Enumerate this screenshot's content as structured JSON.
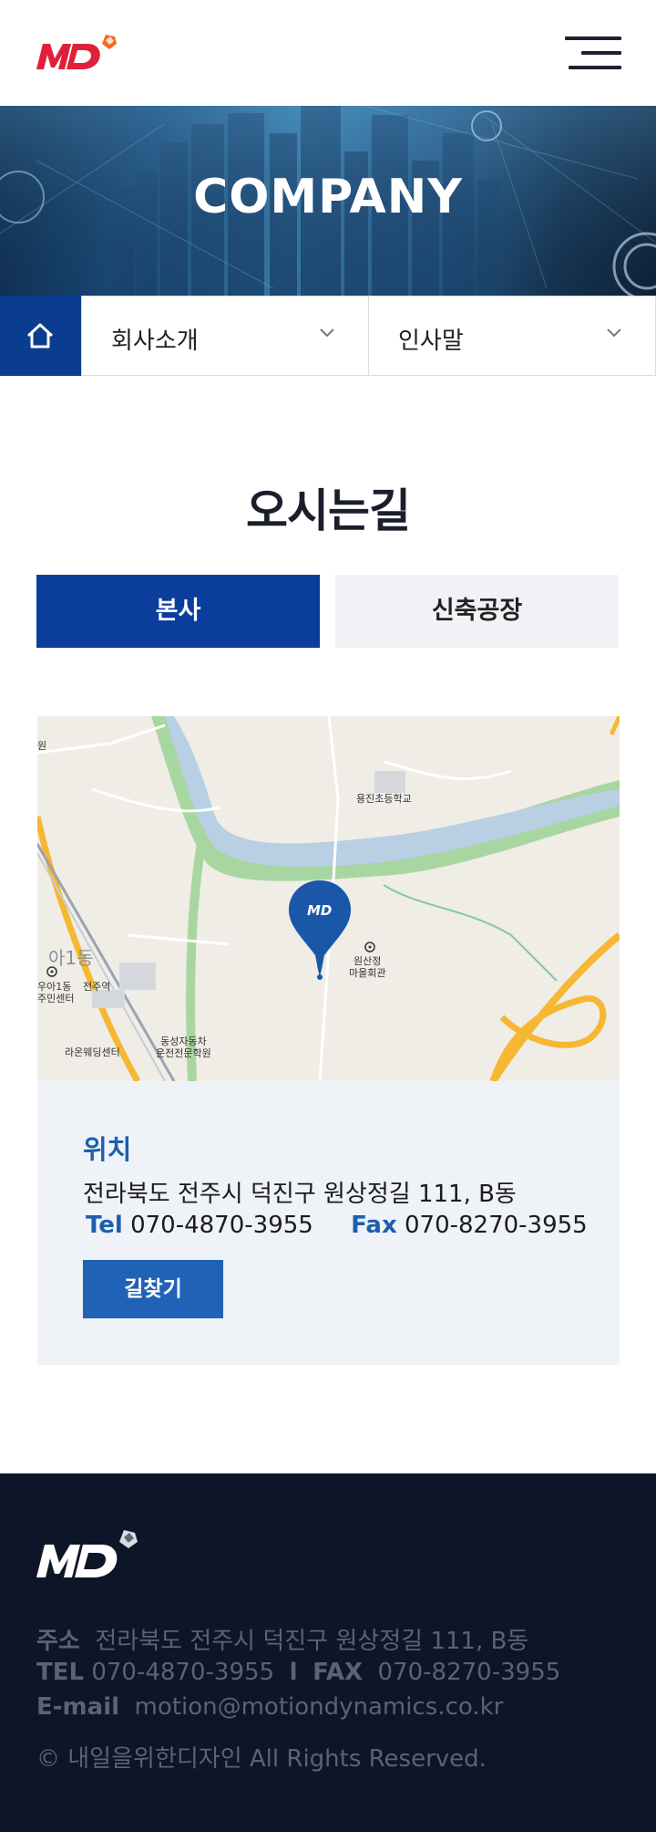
{
  "header": {
    "logo_text": "MD",
    "brand_color": "#e0203a",
    "accent_color": "#f26b1d"
  },
  "banner": {
    "title": "COMPANY"
  },
  "subnav": {
    "home_icon": "home-icon",
    "dropdown1": "회사소개",
    "dropdown2": "인사말"
  },
  "main": {
    "title": "오시는길",
    "tabs": [
      {
        "label": "본사",
        "active": true
      },
      {
        "label": "신축공장",
        "active": false
      }
    ],
    "map": {
      "labels": {
        "school": "용진초등학교",
        "hall": "원산정\n마을회관",
        "station": "전주역",
        "dong": "우아1동\n주민센터",
        "wedding": "라온웨딩센터",
        "driving": "동성자동차\n운전전문학원",
        "edge_top": "원",
        "dong_big": "아1동"
      }
    },
    "info": {
      "title": "위치",
      "address": "전라북도 전주시 덕진구 원상정길 111, B동",
      "tel_label": "Tel",
      "tel": "070-4870-3955",
      "fax_label": "Fax",
      "fax": "070-8270-3955",
      "route_button": "길찾기"
    }
  },
  "footer": {
    "address_label": "주소",
    "address": "전라북도 전주시 덕진구 원상정길 111, B동",
    "tel_label": "TEL",
    "tel": "070-4870-3955",
    "separator": "l",
    "fax_label": "FAX",
    "fax": "070-8270-3955",
    "email_label": "E-mail",
    "email": "motion@motiondynamics.co.kr",
    "copyright": "© 내일을위한디자인  All Rights Reserved."
  },
  "colors": {
    "primary": "#0a3d9c",
    "info_blue": "#1d5fab",
    "footer_bg": "#0d1528"
  }
}
